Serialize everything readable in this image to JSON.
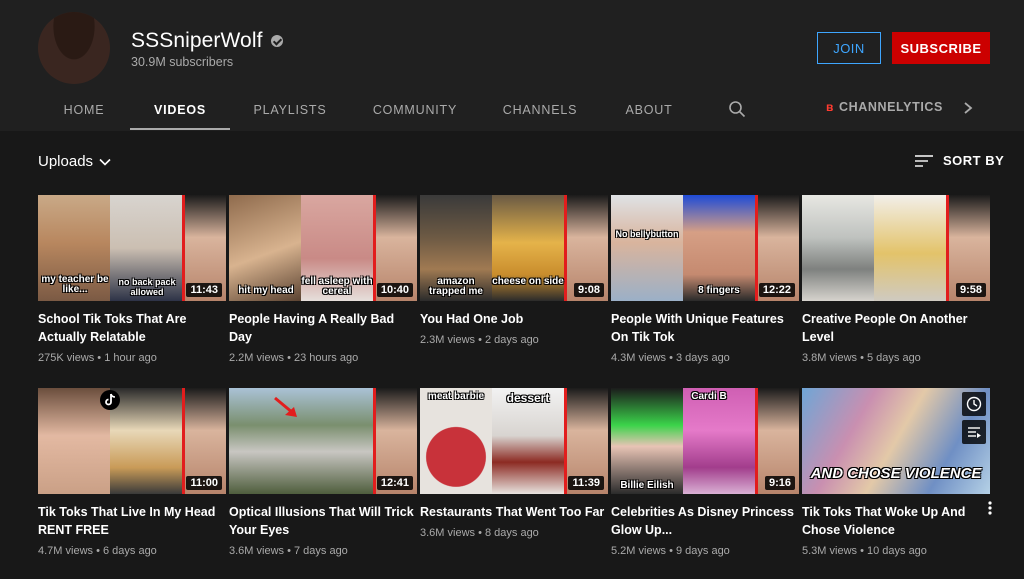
{
  "channel": {
    "name": "SSSniperWolf",
    "subscribers": "30.9M subscribers",
    "join_label": "JOIN",
    "subscribe_label": "SUBSCRIBE"
  },
  "tabs": [
    {
      "label": "HOME"
    },
    {
      "label": "VIDEOS",
      "active": true
    },
    {
      "label": "PLAYLISTS"
    },
    {
      "label": "COMMUNITY"
    },
    {
      "label": "CHANNELS"
    },
    {
      "label": "ABOUT"
    }
  ],
  "channelytics": {
    "logo": "ʙ",
    "label": "CHANNELYTICS"
  },
  "toolbar": {
    "uploads_label": "Uploads",
    "sort_label": "SORT BY"
  },
  "videos": [
    {
      "title": "School Tik Toks That Are Actually Relatable",
      "meta": "275K views • 1 hour ago",
      "duration": "11:43",
      "captions": [
        "my teacher be like...",
        "no back pack allowed"
      ]
    },
    {
      "title": "People Having A Really Bad Day",
      "meta": "2.2M views • 23 hours ago",
      "duration": "10:40",
      "captions": [
        "hit my head",
        "fell asleep with cereal"
      ]
    },
    {
      "title": "You Had One Job",
      "meta": "2.3M views • 2 days ago",
      "duration": "9:08",
      "captions": [
        "amazon trapped me",
        "cheese on side"
      ]
    },
    {
      "title": "People With Unique Features On Tik Tok",
      "meta": "4.3M views • 3 days ago",
      "duration": "12:22",
      "captions": [
        "No bellybutton",
        "8 fingers"
      ]
    },
    {
      "title": "Creative People On Another Level",
      "meta": "3.8M views • 5 days ago",
      "duration": "9:58",
      "captions": []
    },
    {
      "title": "Tik Toks That Live In My Head RENT FREE",
      "meta": "4.7M views • 6 days ago",
      "duration": "11:00",
      "captions": []
    },
    {
      "title": "Optical Illusions That Will Trick Your Eyes",
      "meta": "3.6M views • 7 days ago",
      "duration": "12:41",
      "captions": []
    },
    {
      "title": "Restaurants That Went Too Far",
      "meta": "3.6M views • 8 days ago",
      "duration": "11:39",
      "captions": [
        "meat barbie",
        "dessert"
      ]
    },
    {
      "title": "Celebrities As Disney Princess Glow Up...",
      "meta": "5.2M views • 9 days ago",
      "duration": "9:16",
      "captions": [
        "Billie Eilish",
        "Cardi B"
      ]
    },
    {
      "title": "Tik Toks That Woke Up And Chose Violence",
      "meta": "5.3M views • 10 days ago",
      "duration": "",
      "captions": [
        "AND CHOSE VIOLENCE"
      ]
    }
  ]
}
